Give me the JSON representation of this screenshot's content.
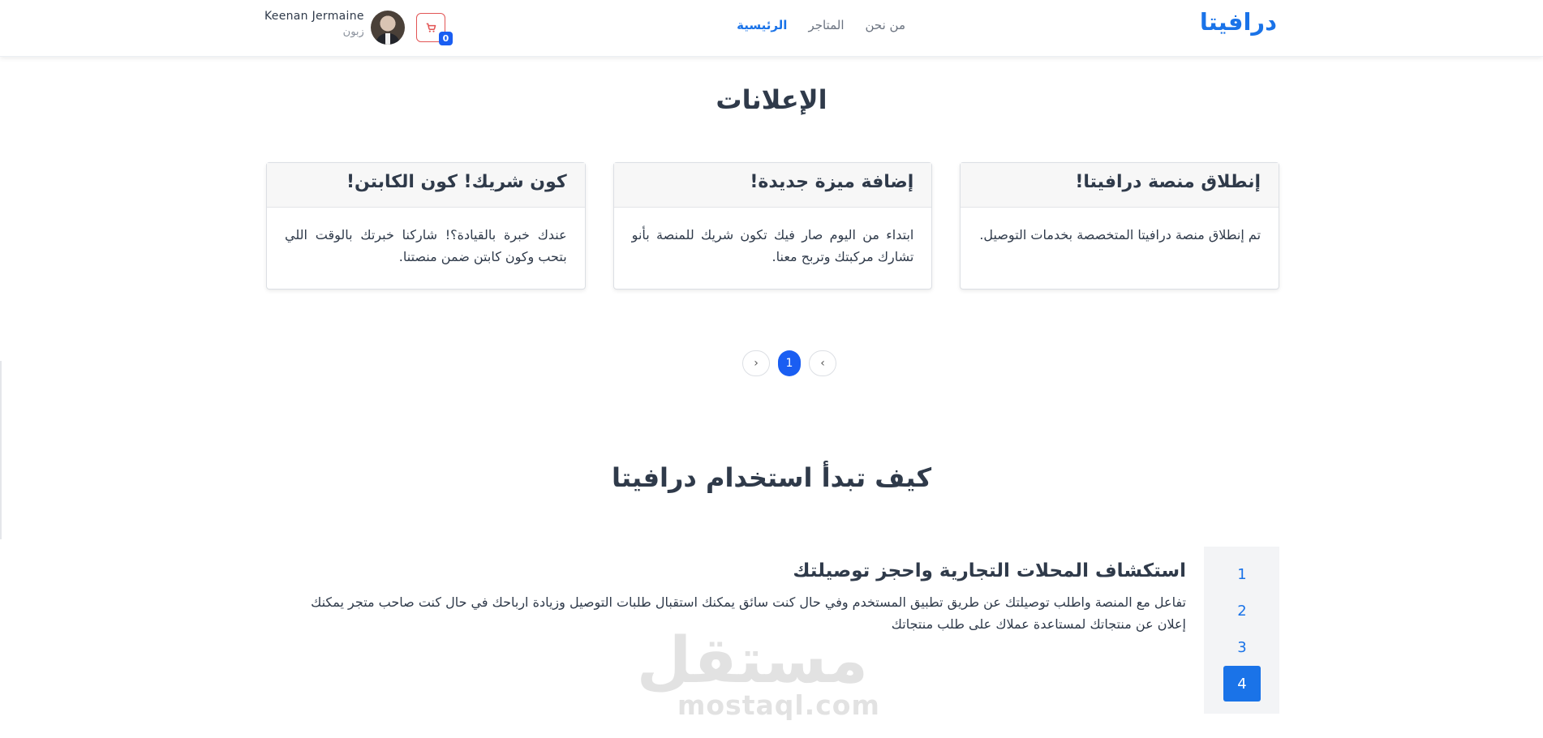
{
  "header": {
    "brand": "درافيتا",
    "nav": [
      {
        "label": "الرئيسية",
        "active": true
      },
      {
        "label": "المتاجر",
        "active": false
      },
      {
        "label": "من نحن",
        "active": false
      }
    ],
    "user": {
      "name": "Keenan Jermaine",
      "role": "زبون"
    },
    "cart": {
      "icon": "cart-icon",
      "count": "0",
      "accent": "#e25555"
    }
  },
  "announcements": {
    "title": "الإعلانات",
    "cards": [
      {
        "title": "كون شريك! كون الكابتن!",
        "body": "عندك خبرة بالقيادة؟! شاركنا خبرتك بالوقت اللي بتحب وكون كابتن ضمن منصتنا."
      },
      {
        "title": "إضافة ميزة جديدة!",
        "body": "ابتداء من اليوم صار فيك تكون شريك للمنصة بأنو تشارك مركبتك وتربح معنا."
      },
      {
        "title": "إنطلاق منصة درافيتا!",
        "body": "تم إنطلاق منصة درافيتا المتخصصة بخدمات التوصيل."
      }
    ],
    "pagination": {
      "prev": "‹",
      "current": "1",
      "next": "›"
    }
  },
  "how_to": {
    "title": "كيف تبدأ استخدام درافيتا",
    "steps": [
      "1",
      "2",
      "3",
      "4"
    ],
    "active_step": "4",
    "step_title": "استكشاف المحلات التجارية واحجز توصيلتك",
    "step_desc": "تفاعل مع المنصة واطلب توصيلتك عن طريق تطبيق المستخدم وفي حال كنت سائق يمكنك استقبال طلبات التوصيل وزيادة ارباحك في حال كنت صاحب متجر يمكنك إعلان عن منتجاتك لمستاعدة عملاك على طلب منتجاتك"
  },
  "watermark": {
    "ar": "مستقل",
    "en": "mostaql.com"
  },
  "colors": {
    "primary": "#1a73e8",
    "badge": "#1a5ef2"
  }
}
